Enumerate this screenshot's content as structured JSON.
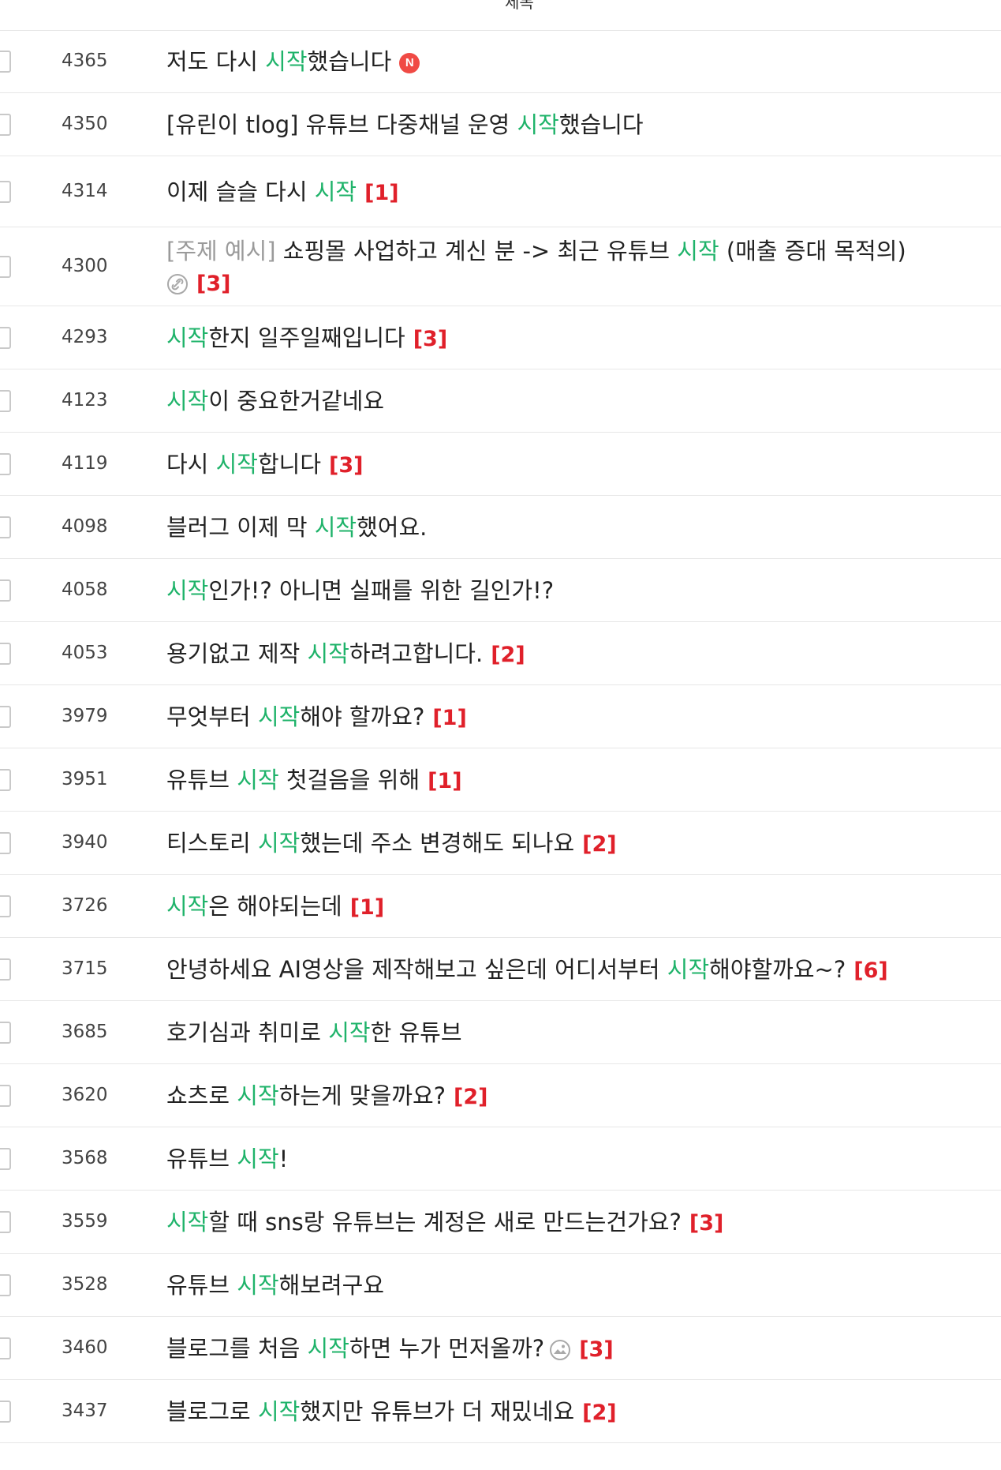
{
  "header": {
    "column_title": "제목"
  },
  "posts": [
    {
      "number": "4365",
      "before": "저도 다시 ",
      "keyword": "시작",
      "after": "했습니다",
      "new_badge": "N"
    },
    {
      "number": "4350",
      "before": "[유린이 tlog] 유튜브 다중채널 운영 ",
      "keyword": "시작",
      "after": "했습니다"
    },
    {
      "number": "4314",
      "before": "이제 슬슬 다시 ",
      "keyword": "시작",
      "after": "",
      "comments": "[1]"
    },
    {
      "number": "4300",
      "prefix": "[주제 예시]",
      "before": " 쇼핑몰 사업하고 계신 분 -> 최근 유튜브 ",
      "keyword": "시작",
      "after": " (매출 증대 목적의)",
      "attachment_icon": "link-icon",
      "comments": "[3]"
    },
    {
      "number": "4293",
      "before": "",
      "keyword": "시작",
      "after": "한지 일주일째입니다",
      "comments": "[3]"
    },
    {
      "number": "4123",
      "before": "",
      "keyword": "시작",
      "after": "이 중요한거같네요"
    },
    {
      "number": "4119",
      "before": "다시 ",
      "keyword": "시작",
      "after": "합니다",
      "comments": "[3]"
    },
    {
      "number": "4098",
      "before": "블러그 이제 막 ",
      "keyword": "시작",
      "after": "했어요."
    },
    {
      "number": "4058",
      "before": "",
      "keyword": "시작",
      "after": "인가!? 아니면 실패를 위한 길인가!?"
    },
    {
      "number": "4053",
      "before": "용기없고 제작 ",
      "keyword": "시작",
      "after": "하려고합니다.",
      "comments": "[2]"
    },
    {
      "number": "3979",
      "before": "무엇부터 ",
      "keyword": "시작",
      "after": "해야 할까요?",
      "comments": "[1]"
    },
    {
      "number": "3951",
      "before": "유튜브 ",
      "keyword": "시작",
      "after": " 첫걸음을 위해",
      "comments": "[1]"
    },
    {
      "number": "3940",
      "before": "티스토리 ",
      "keyword": "시작",
      "after": "했는데 주소 변경해도 되나요",
      "comments": "[2]"
    },
    {
      "number": "3726",
      "before": "",
      "keyword": "시작",
      "after": "은 해야되는데",
      "comments": "[1]"
    },
    {
      "number": "3715",
      "before": "안녕하세요 AI영상을 제작해보고 싶은데 어디서부터 ",
      "keyword": "시작",
      "after": "해야할까요~?",
      "comments": "[6]"
    },
    {
      "number": "3685",
      "before": "호기심과 취미로 ",
      "keyword": "시작",
      "after": "한 유튜브"
    },
    {
      "number": "3620",
      "before": "쇼츠로 ",
      "keyword": "시작",
      "after": "하는게 맞을까요?",
      "comments": "[2]"
    },
    {
      "number": "3568",
      "before": "유튜브 ",
      "keyword": "시작",
      "after": "!"
    },
    {
      "number": "3559",
      "before": "",
      "keyword": "시작",
      "after": "할 때 sns랑 유튜브는 계정은 새로 만드는건가요?",
      "comments": "[3]"
    },
    {
      "number": "3528",
      "before": "유튜브 ",
      "keyword": "시작",
      "after": "해보려구요"
    },
    {
      "number": "3460",
      "before": "블로그를 처음 ",
      "keyword": "시작",
      "after": "하면 누가 먼저올까?",
      "attachment_icon": "image-icon",
      "comments": "[3]"
    },
    {
      "number": "3437",
      "before": "블로그로 ",
      "keyword": "시작",
      "after": "했지만 유튜브가 더 재밌네요",
      "comments": "[2]"
    }
  ]
}
